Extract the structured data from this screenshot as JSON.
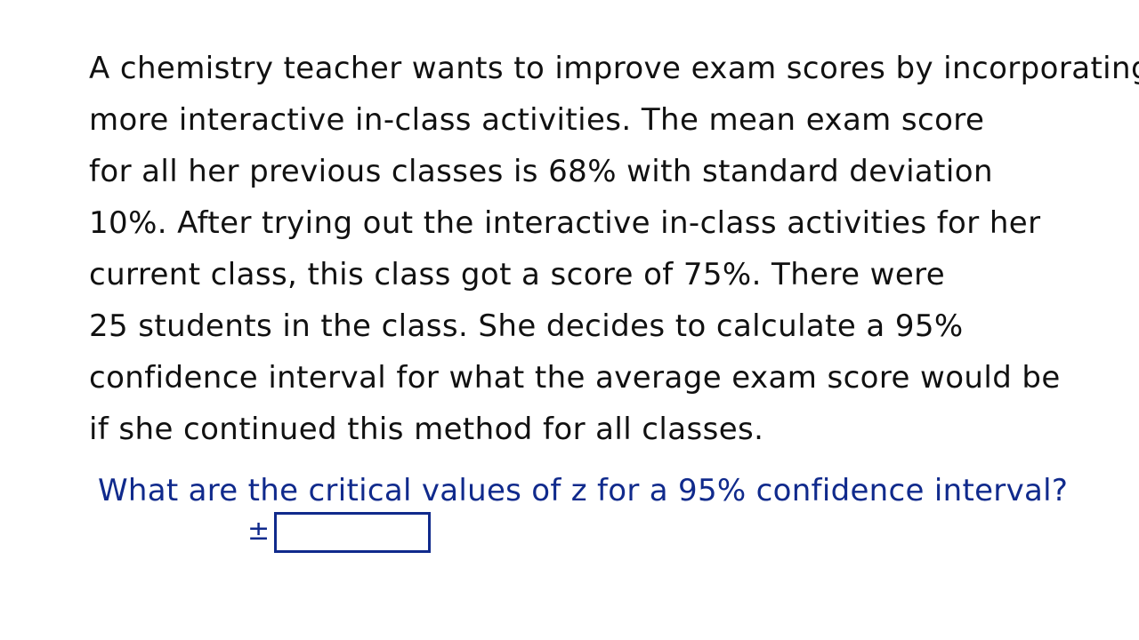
{
  "problem": {
    "lines": [
      "A chemistry teacher wants to improve exam scores by incorporating",
      "more interactive in-class activities. The mean exam score",
      "for all her previous classes is 68% with standard deviation",
      "10%. After trying out the interactive in-class activities for her",
      "current class, this class got a score of 75%. There were",
      "25 students in the class. She decides to calculate a 95%",
      "confidence interval for what the average exam score would be",
      "if she continued this method for all classes."
    ]
  },
  "question": {
    "text": "What are the critical values of z for a 95% confidence interval?",
    "prefix_symbol": "±",
    "answer_value": ""
  },
  "colors": {
    "problem_text": "#111111",
    "question_text": "#102a8c",
    "answer_box_border": "#102a8c",
    "background": "#ffffff"
  }
}
